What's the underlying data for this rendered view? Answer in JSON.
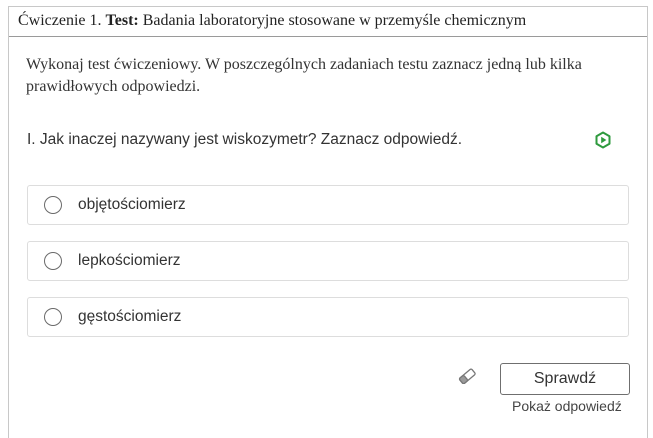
{
  "header": {
    "exercise": "Ćwiczenie 1.",
    "test_label": "Test:",
    "title": "Badania laboratoryjne stosowane w przemyśle chemicznym"
  },
  "instructions": "Wykonaj test ćwiczeniowy. W poszczególnych zadaniach testu zaznacz jedną lub kilka prawidłowych odpowiedzi.",
  "question": {
    "text": "I. Jak inaczej nazywany jest wiskozymetr? Zaznacz odpowiedź.",
    "icon": "hexagon-play-icon",
    "icon_color": "#2e9a3e"
  },
  "options": [
    {
      "label": "objętościomierz",
      "selected": false
    },
    {
      "label": "lepkościomierz",
      "selected": false
    },
    {
      "label": "gęstościomierz",
      "selected": false
    }
  ],
  "actions": {
    "eraser_icon": "eraser-icon",
    "check_label": "Sprawdź",
    "show_answer_label": "Pokaż odpowiedź"
  }
}
